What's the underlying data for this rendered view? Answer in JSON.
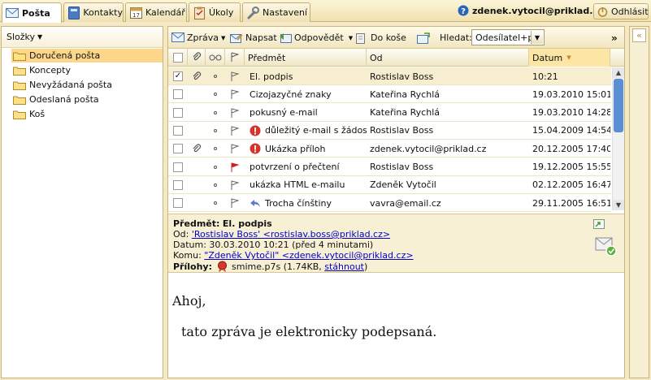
{
  "tabs": [
    {
      "label": "Pošta",
      "icon": "envelope-icon"
    },
    {
      "label": "Kontakty",
      "icon": "address-book-icon"
    },
    {
      "label": "Kalendář",
      "icon": "calendar-icon"
    },
    {
      "label": "Úkoly",
      "icon": "clipboard-icon"
    },
    {
      "label": "Nastavení",
      "icon": "wrench-icon"
    }
  ],
  "account": {
    "user": "zdenek.vytocil@priklad.cz",
    "logout_label": "Odhlásit"
  },
  "sidebar": {
    "header": "Složky",
    "folders": [
      {
        "label": "Doručená pošta",
        "selected": true
      },
      {
        "label": "Koncepty"
      },
      {
        "label": "Nevyžádaná pošta"
      },
      {
        "label": "Odeslaná pošta"
      },
      {
        "label": "Koš"
      }
    ]
  },
  "toolbar": {
    "message_label": "Zpráva",
    "compose_label": "Napsat",
    "reply_label": "Odpovědět",
    "move_label": "Do koše",
    "search_label": "Hledat:",
    "search_select": "Odesílatel+př"
  },
  "columns": {
    "subject": "Předmět",
    "from": "Od",
    "date": "Datum"
  },
  "messages": [
    {
      "subject": "El. podpis",
      "from": "Rostislav Boss",
      "date": "10:21",
      "checked": true,
      "attach": true,
      "flag": "none",
      "important": false,
      "selected": true
    },
    {
      "subject": "Cizojazyčné znaky",
      "from": "Kateřina Rychlá",
      "date": "19.03.2010 15:01",
      "flag": "none"
    },
    {
      "subject": "pokusný e-mail",
      "from": "Kateřina Rychlá",
      "date": "19.03.2010 14:28",
      "flag": "none"
    },
    {
      "subject": "důležitý e-mail s žádostí o",
      "from": "Rostislav Boss",
      "date": "15.04.2009 14:54",
      "flag": "none",
      "important": true
    },
    {
      "subject": "Ukázka příloh",
      "from": "zdenek.vytocil@priklad.cz",
      "date": "20.12.2005 17:40",
      "attach": true,
      "flag": "none",
      "important": true
    },
    {
      "subject": "potvrzení o přečtení",
      "from": "Rostislav Boss",
      "date": "19.12.2005 15:55",
      "flag": "red"
    },
    {
      "subject": "ukázka HTML e-mailu",
      "from": "Zdeněk Vytočil",
      "date": "02.12.2005 16:47",
      "flag": "none"
    },
    {
      "subject": "Trocha čínštiny",
      "from": "vavra@email.cz",
      "date": "29.11.2005 16:51",
      "flag": "none",
      "reply": true
    }
  ],
  "preview": {
    "subject_label": "Předmět:",
    "subject": "El. podpis",
    "from_label": "Od:",
    "from": "'Rostislav Boss' <rostislav.boss@priklad.cz>",
    "date_label": "Datum:",
    "date": "30.03.2010 10:21 (před 4 minutami)",
    "to_label": "Komu:",
    "to": "\"Zdeněk Vytočil\" <zdenek.vytocil@priklad.cz>",
    "attach_label": "Přílohy:",
    "attach_name": "smime.p7s (1.74KB,",
    "attach_download": "stáhnout",
    "attach_close": ")",
    "body_greeting": "Ahoj,",
    "body_text": "tato zpráva je elektronicky podepsaná."
  },
  "colors": {
    "accent": "#fcd68a",
    "header_bg": "#f8f0d4",
    "link": "#0000cc",
    "scroll": "#5b8fd3"
  }
}
